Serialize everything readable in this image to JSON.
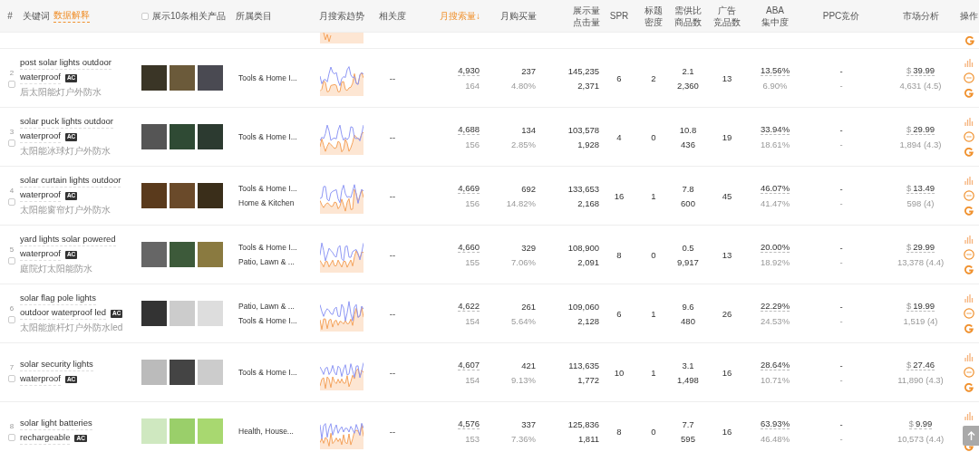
{
  "header": {
    "number": "#",
    "keyword": "关键词",
    "data_explain": "数据解释",
    "show_related": {
      "label": "展示10条相关产品",
      "checked": false
    },
    "columns": [
      {
        "lines": [
          "所属类目"
        ],
        "sorted": false
      },
      {
        "lines": [
          "月搜索趋势"
        ],
        "sorted": false
      },
      {
        "lines": [
          "相关度"
        ],
        "sorted": false
      },
      {
        "lines": [
          "月搜索量↓"
        ],
        "sorted": true
      },
      {
        "lines": [
          "月购买量"
        ],
        "sorted": false
      },
      {
        "lines": [
          "展示量",
          "点击量"
        ],
        "sorted": false
      },
      {
        "lines": [
          "SPR"
        ],
        "sorted": false
      },
      {
        "lines": [
          "标题",
          "密度"
        ],
        "sorted": false
      },
      {
        "lines": [
          "需供比",
          "商品数"
        ],
        "sorted": false
      },
      {
        "lines": [
          "广告",
          "竞品数"
        ],
        "sorted": false
      },
      {
        "lines": [
          "ABA",
          "集中度"
        ],
        "sorted": false
      },
      {
        "lines": [
          "PPC竞价"
        ],
        "sorted": false
      },
      {
        "lines": [
          "市场分析"
        ],
        "sorted": false
      },
      {
        "lines": [
          "操作"
        ],
        "sorted": false
      }
    ]
  },
  "rows": [
    {
      "index": "2",
      "checked": false,
      "keyword_lines": [
        "post solar lights outdoor",
        "waterproof"
      ],
      "badge": "AC",
      "zh": "后太阳能灯户外防水",
      "categories": [
        "Tools & Home I..."
      ],
      "relevance": "--",
      "search": "4,930",
      "search_sub": "164",
      "purchases": "237",
      "purchase_rate": "4.80%",
      "impressions": "145,235",
      "clicks": "2,371",
      "spr": "6",
      "title_density": "2",
      "demand_ratio": "2.1",
      "products": "2,360",
      "ad_products": "13",
      "aba": "13.56%",
      "aba_sub": "6.90%",
      "ppc": "-",
      "ppc_sub": "-",
      "currency": "$",
      "price": "39.99",
      "reviews": "4,631 (4.5)"
    },
    {
      "index": "3",
      "checked": false,
      "keyword_lines": [
        "solar puck lights outdoor",
        "waterproof"
      ],
      "badge": "AC",
      "zh": "太阳能冰球灯户外防水",
      "categories": [
        "Tools & Home I..."
      ],
      "relevance": "--",
      "search": "4,688",
      "search_sub": "156",
      "purchases": "134",
      "purchase_rate": "2.85%",
      "impressions": "103,578",
      "clicks": "1,928",
      "spr": "4",
      "title_density": "0",
      "demand_ratio": "10.8",
      "products": "436",
      "ad_products": "19",
      "aba": "33.94%",
      "aba_sub": "18.61%",
      "ppc": "-",
      "ppc_sub": "-",
      "currency": "$",
      "price": "29.99",
      "reviews": "1,894 (4.3)"
    },
    {
      "index": "4",
      "checked": false,
      "keyword_lines": [
        "solar curtain lights outdoor",
        "waterproof"
      ],
      "badge": "AC",
      "zh": "太阳能窗帘灯户外防水",
      "categories": [
        "Tools & Home I...",
        "Home & Kitchen"
      ],
      "relevance": "--",
      "search": "4,669",
      "search_sub": "156",
      "purchases": "692",
      "purchase_rate": "14.82%",
      "impressions": "133,653",
      "clicks": "2,168",
      "spr": "16",
      "title_density": "1",
      "demand_ratio": "7.8",
      "products": "600",
      "ad_products": "45",
      "aba": "46.07%",
      "aba_sub": "41.47%",
      "ppc": "-",
      "ppc_sub": "-",
      "currency": "$",
      "price": "13.49",
      "reviews": "598 (4)"
    },
    {
      "index": "5",
      "checked": false,
      "keyword_lines": [
        "yard lights solar powered",
        "waterproof"
      ],
      "badge": "AC",
      "zh": "庭院灯太阳能防水",
      "categories": [
        "Tools & Home I...",
        "Patio, Lawn & ..."
      ],
      "relevance": "--",
      "search": "4,660",
      "search_sub": "155",
      "purchases": "329",
      "purchase_rate": "7.06%",
      "impressions": "108,900",
      "clicks": "2,091",
      "spr": "8",
      "title_density": "0",
      "demand_ratio": "0.5",
      "products": "9,917",
      "ad_products": "13",
      "aba": "20.00%",
      "aba_sub": "18.92%",
      "ppc": "-",
      "ppc_sub": "-",
      "currency": "$",
      "price": "29.99",
      "reviews": "13,378 (4.4)"
    },
    {
      "index": "6",
      "checked": false,
      "keyword_lines": [
        "solar flag pole lights",
        "outdoor waterproof led"
      ],
      "badge": "AC",
      "zh": "太阳能旗杆灯户外防水led",
      "categories": [
        "Patio, Lawn & ...",
        "Tools & Home I..."
      ],
      "relevance": "--",
      "search": "4,622",
      "search_sub": "154",
      "purchases": "261",
      "purchase_rate": "5.64%",
      "impressions": "109,060",
      "clicks": "2,128",
      "spr": "6",
      "title_density": "1",
      "demand_ratio": "9.6",
      "products": "480",
      "ad_products": "26",
      "aba": "22.29%",
      "aba_sub": "24.53%",
      "ppc": "-",
      "ppc_sub": "-",
      "currency": "$",
      "price": "19.99",
      "reviews": "1,519 (4)"
    },
    {
      "index": "7",
      "checked": false,
      "keyword_lines": [
        "solar security lights",
        "waterproof"
      ],
      "badge": "AC",
      "categories": [
        "Tools & Home I..."
      ],
      "relevance": "--",
      "search": "4,607",
      "search_sub": "154",
      "purchases": "421",
      "purchase_rate": "9.13%",
      "impressions": "113,635",
      "clicks": "1,772",
      "spr": "10",
      "title_density": "1",
      "demand_ratio": "3.1",
      "products": "1,498",
      "ad_products": "16",
      "aba": "28.64%",
      "aba_sub": "10.71%",
      "ppc": "-",
      "ppc_sub": "-",
      "currency": "$",
      "price": "27.46",
      "reviews": "11,890 (4.3)"
    },
    {
      "index": "8",
      "checked": false,
      "keyword_lines": [
        "solar light batteries",
        "rechargeable"
      ],
      "badge": "AC",
      "categories": [
        "Health, House..."
      ],
      "relevance": "--",
      "search": "4,576",
      "search_sub": "153",
      "purchases": "337",
      "purchase_rate": "7.36%",
      "impressions": "125,836",
      "clicks": "1,811",
      "spr": "8",
      "title_density": "0",
      "demand_ratio": "7.7",
      "products": "595",
      "ad_products": "16",
      "aba": "63.93%",
      "aba_sub": "46.48%",
      "ppc": "-",
      "ppc_sub": "-",
      "currency": "$",
      "price": "9.99",
      "reviews": "10,573 (4.4)"
    }
  ]
}
